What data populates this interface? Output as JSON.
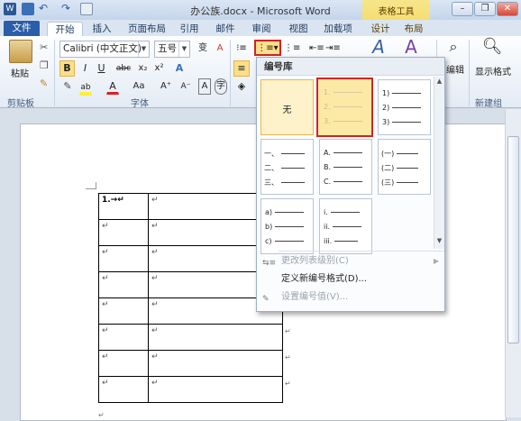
{
  "title": "办公族.docx - Microsoft Word",
  "contextual_tab": "表格工具",
  "window_buttons": [
    "–",
    "❐",
    "✕"
  ],
  "tabs": [
    "文件",
    "开始",
    "插入",
    "页面布局",
    "引用",
    "邮件",
    "审阅",
    "视图",
    "加载项",
    "设计",
    "布局"
  ],
  "active_tab": "开始",
  "ribbon": {
    "paste": "粘贴",
    "font_name": "Calibri (中文正文)",
    "font_size": "五号",
    "groups": [
      "剪贴板",
      "字体",
      "新建组"
    ],
    "editing": "编辑",
    "show_format": "显示格式",
    "style": "格",
    "format_buttons": [
      "B",
      "I",
      "U",
      "abc",
      "x₂",
      "x²"
    ],
    "font_case": "Aa",
    "grow_font": "A⁺",
    "shrink_font": "A⁻"
  },
  "dropdown": {
    "header": "编号库",
    "none_label": "无",
    "styles": [
      [
        "无"
      ],
      [
        "1.",
        "2.",
        "3."
      ],
      [
        "1)",
        "2)",
        "3)"
      ],
      [
        "一、",
        "二、",
        "三、"
      ],
      [
        "A.",
        "B.",
        "C."
      ],
      [
        "(一)",
        "(二)",
        "(三)"
      ],
      [
        "a)",
        "b)",
        "c)"
      ],
      [
        "i.",
        "ii.",
        "iii."
      ]
    ],
    "menu": [
      {
        "label": "更改列表级别(C)",
        "disabled": true
      },
      {
        "label": "定义新编号格式(D)...",
        "disabled": false
      },
      {
        "label": "设置编号值(V)...",
        "disabled": true
      }
    ]
  },
  "document": {
    "first_cell": "1.→",
    "cell_mark": "↵"
  }
}
